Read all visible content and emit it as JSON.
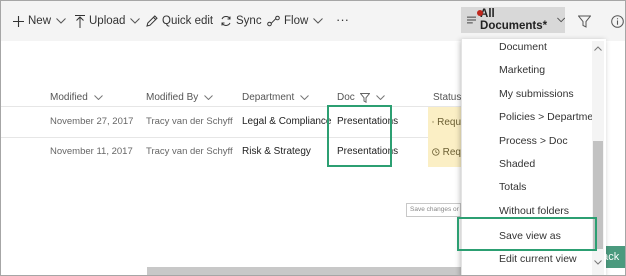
{
  "toolbar": {
    "new_label": "New",
    "upload_label": "Upload",
    "quick_edit_label": "Quick edit",
    "sync_label": "Sync",
    "flow_label": "Flow",
    "more_label": "···",
    "view_label": "All Documents*"
  },
  "columns": {
    "modified": "Modified",
    "modified_by": "Modified By",
    "department": "Department",
    "doc": "Doc",
    "status": "Status"
  },
  "rows": [
    {
      "modified": "November 27, 2017",
      "modified_by": "Tracy van der Schyff",
      "department": "Legal & Compliance",
      "doc": "Presentations",
      "status": "Requ"
    },
    {
      "modified": "November 11, 2017",
      "modified_by": "Tracy van der Schyff",
      "department": "Risk & Strategy",
      "doc": "Presentations",
      "status": "Req"
    }
  ],
  "tooltip_text": "Save changes or create a new view",
  "back_button_label": "back",
  "view_menu": {
    "items": [
      "Document",
      "Marketing",
      "My submissions",
      "Policies > Department",
      "Process > Doc",
      "Shaded",
      "Totals",
      "Without folders",
      "Save view as",
      "Edit current view"
    ]
  },
  "colors": {
    "highlight_border": "#2c9f72",
    "status_bg": "#fbefc5",
    "command_bar_bg": "#f4f4f4",
    "notification_dot": "#c0271d"
  },
  "icons": {
    "new": "plus-icon",
    "upload": "upload-arrow-icon",
    "quick_edit": "pencil-icon",
    "sync": "sync-icon",
    "flow": "flow-icon",
    "view": "view-list-icon",
    "filter": "filter-icon",
    "info": "info-icon",
    "status": "clock-icon"
  }
}
